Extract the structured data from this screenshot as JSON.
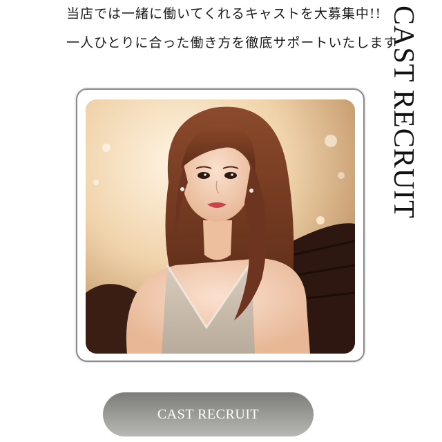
{
  "intro": {
    "line1": "当店では一緒に働いてくれるキャストを大募集中!!",
    "line2": "一人ひとりに合った働き方を徹底サポートいたします"
  },
  "heading": {
    "vertical_title": "CAST RECRUIT"
  },
  "photo": {
    "subject": "woman-portrait-in-lounge"
  },
  "cta": {
    "label": "CAST RECRUIT"
  },
  "colors": {
    "button_gradient_top": "#7c7c78",
    "button_gradient_bottom": "#b8b8b4",
    "frame_border": "#8a8a8a",
    "text": "#1a1a1a"
  }
}
